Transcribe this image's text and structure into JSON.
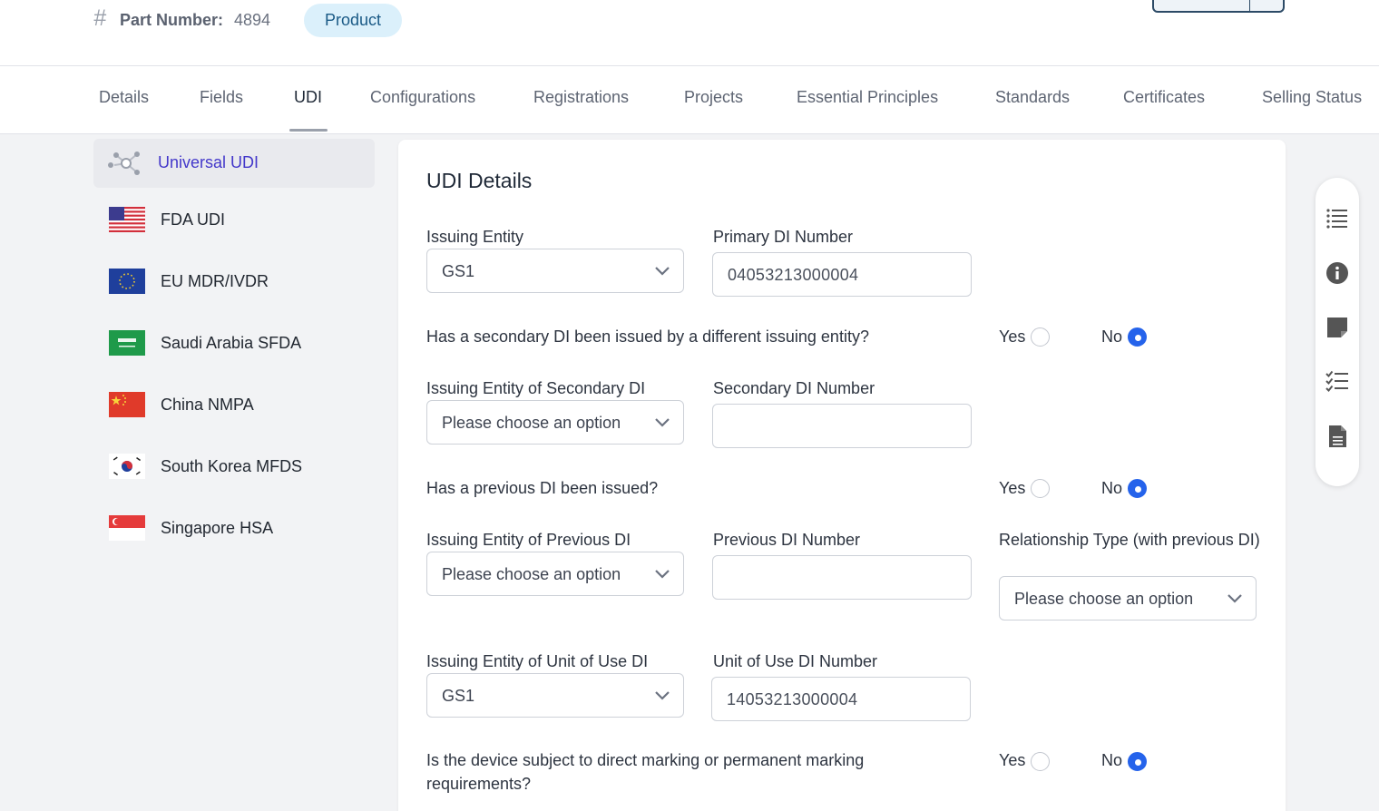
{
  "header": {
    "part_number_label": "Part Number:",
    "part_number_value": "4894",
    "badge": "Product"
  },
  "tabs": [
    {
      "label": "Details"
    },
    {
      "label": "Fields"
    },
    {
      "label": "UDI",
      "active": true
    },
    {
      "label": "Configurations"
    },
    {
      "label": "Registrations"
    },
    {
      "label": "Projects"
    },
    {
      "label": "Essential Principles"
    },
    {
      "label": "Standards"
    },
    {
      "label": "Certificates"
    },
    {
      "label": "Selling Status"
    }
  ],
  "sidebar": {
    "items": [
      {
        "label": "Universal UDI",
        "icon": "network-icon",
        "active": true
      },
      {
        "label": "FDA UDI",
        "icon": "us-flag-icon"
      },
      {
        "label": "EU MDR/IVDR",
        "icon": "eu-flag-icon"
      },
      {
        "label": "Saudi Arabia SFDA",
        "icon": "saudi-flag-icon"
      },
      {
        "label": "China NMPA",
        "icon": "china-flag-icon"
      },
      {
        "label": "South Korea MFDS",
        "icon": "korea-flag-icon"
      },
      {
        "label": "Singapore HSA",
        "icon": "singapore-flag-icon"
      }
    ]
  },
  "form": {
    "title": "UDI Details",
    "issuing_entity": {
      "label": "Issuing Entity",
      "value": "GS1"
    },
    "primary_di": {
      "label": "Primary DI Number",
      "value": "04053213000004"
    },
    "q_secondary": {
      "text": "Has a secondary DI been issued by a different issuing entity?",
      "yes": "Yes",
      "no": "No",
      "selected": "No"
    },
    "secondary_entity": {
      "label": "Issuing Entity of Secondary DI",
      "value": "Please choose an option"
    },
    "secondary_di": {
      "label": "Secondary DI Number",
      "value": ""
    },
    "q_previous": {
      "text": "Has a previous DI been issued?",
      "yes": "Yes",
      "no": "No",
      "selected": "No"
    },
    "previous_entity": {
      "label": "Issuing Entity of Previous DI",
      "value": "Please choose an option"
    },
    "previous_di": {
      "label": "Previous DI Number",
      "value": ""
    },
    "relationship": {
      "label": "Relationship Type (with previous DI)",
      "value": "Please choose an option"
    },
    "unit_entity": {
      "label": "Issuing Entity of Unit of Use DI",
      "value": "GS1"
    },
    "unit_di": {
      "label": "Unit of Use DI Number",
      "value": "14053213000004"
    },
    "q_marking": {
      "text": "Is the device subject to direct marking or permanent marking requirements?",
      "yes": "Yes",
      "no": "No",
      "selected": "No"
    }
  },
  "rail": {
    "icons": [
      "list-icon",
      "info-icon",
      "note-icon",
      "checklist-icon",
      "document-icon"
    ]
  },
  "colors": {
    "accent": "#2563eb",
    "active_nav": "#4338ca",
    "badge_bg": "#dbf0fb"
  }
}
